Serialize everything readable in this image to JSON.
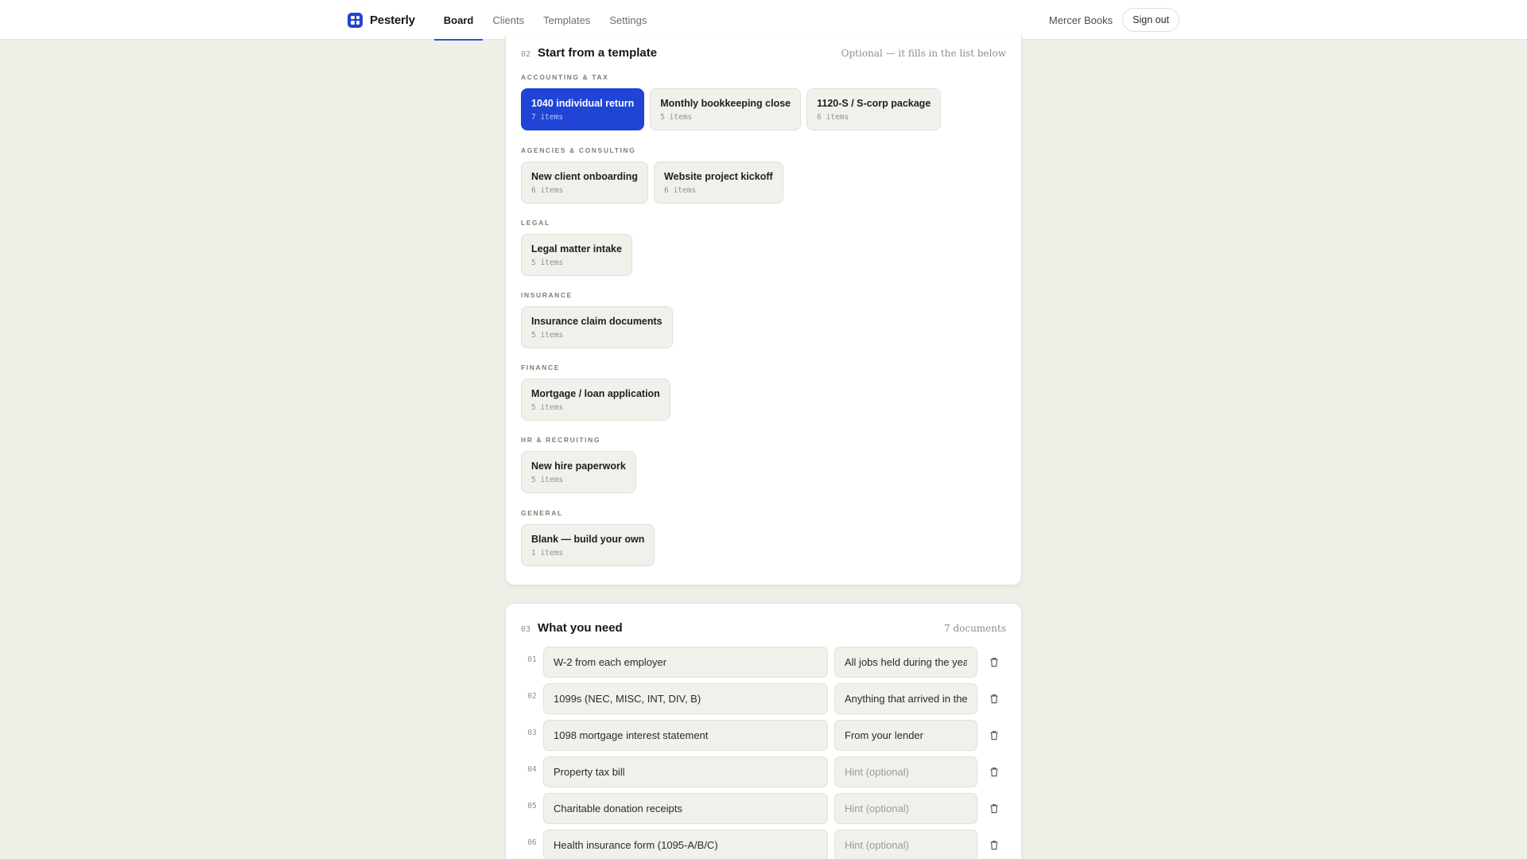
{
  "brand": {
    "name": "Pesterly",
    "logo_icon": "grid-logo-icon",
    "accent": "#1f44d6"
  },
  "nav": {
    "tabs": [
      {
        "label": "Board",
        "active": true
      },
      {
        "label": "Clients",
        "active": false
      },
      {
        "label": "Templates",
        "active": false
      },
      {
        "label": "Settings",
        "active": false
      }
    ]
  },
  "account": {
    "name": "Mercer Books",
    "signout_label": "Sign out"
  },
  "templates": {
    "number": "02",
    "title": "Start from a template",
    "note": "Optional — it fills in the list below",
    "groups": [
      {
        "label": "Accounting & Tax",
        "items": [
          {
            "title": "1040 individual return",
            "count": "7 items",
            "selected": true
          },
          {
            "title": "Monthly bookkeeping close",
            "count": "5 items",
            "selected": false
          },
          {
            "title": "1120-S / S-corp package",
            "count": "6 items",
            "selected": false
          }
        ]
      },
      {
        "label": "Agencies & Consulting",
        "items": [
          {
            "title": "New client onboarding",
            "count": "6 items"
          },
          {
            "title": "Website project kickoff",
            "count": "6 items"
          }
        ]
      },
      {
        "label": "Legal",
        "items": [
          {
            "title": "Legal matter intake",
            "count": "5 items"
          }
        ]
      },
      {
        "label": "Insurance",
        "items": [
          {
            "title": "Insurance claim documents",
            "count": "5 items"
          }
        ]
      },
      {
        "label": "Finance",
        "items": [
          {
            "title": "Mortgage / loan application",
            "count": "5 items"
          }
        ]
      },
      {
        "label": "HR & Recruiting",
        "items": [
          {
            "title": "New hire paperwork",
            "count": "5 items"
          }
        ]
      },
      {
        "label": "General",
        "items": [
          {
            "title": "Blank — build your own",
            "count": "1 items"
          }
        ]
      }
    ]
  },
  "needs": {
    "number": "03",
    "title": "What you need",
    "count_label": "7 documents",
    "hint_placeholder": "Hint (optional)",
    "rows": [
      {
        "num": "01",
        "name": "W-2 from each employer",
        "hint": "All jobs held during the year"
      },
      {
        "num": "02",
        "name": "1099s (NEC, MISC, INT, DIV, B)",
        "hint": "Anything that arrived in the mail"
      },
      {
        "num": "03",
        "name": "1098 mortgage interest statement",
        "hint": "From your lender"
      },
      {
        "num": "04",
        "name": "Property tax bill",
        "hint": ""
      },
      {
        "num": "05",
        "name": "Charitable donation receipts",
        "hint": ""
      },
      {
        "num": "06",
        "name": "Health insurance form (1095-A/B/C)",
        "hint": ""
      }
    ]
  }
}
